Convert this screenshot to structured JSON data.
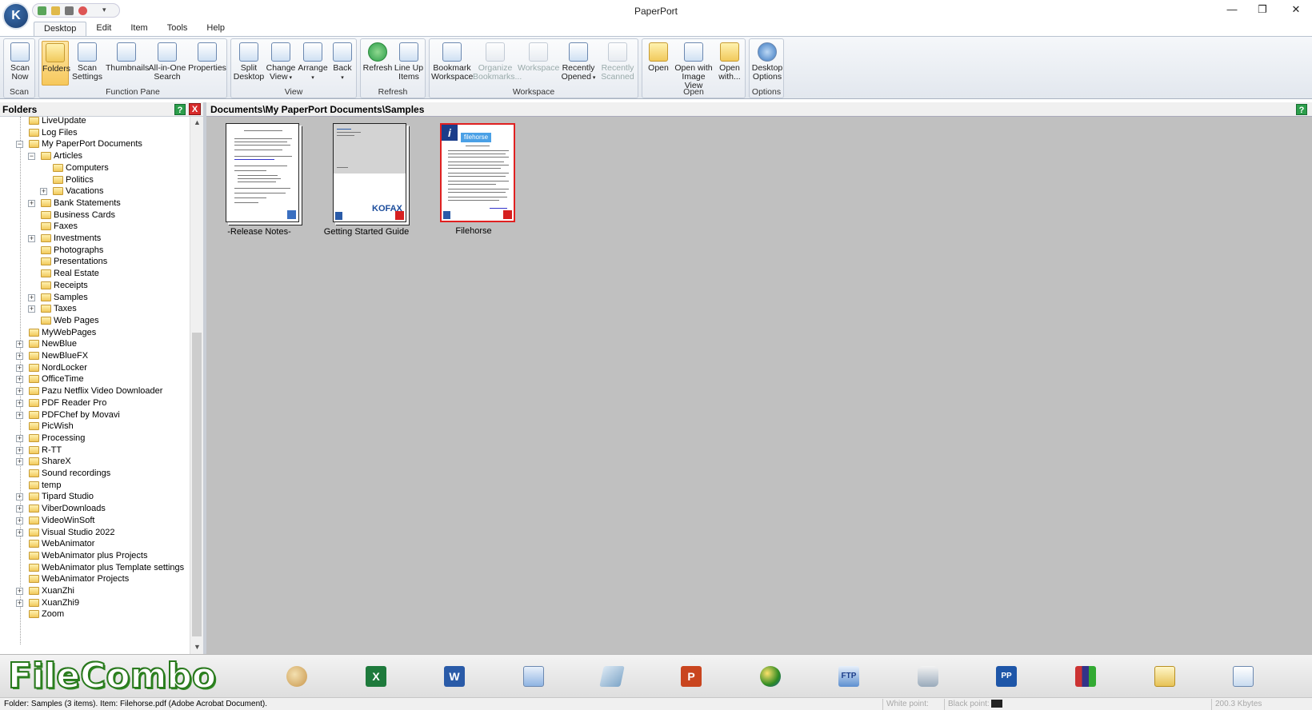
{
  "window": {
    "title": "PaperPort",
    "app_badge": "K PP",
    "minimize": "—",
    "restore": "❐",
    "close": "✕"
  },
  "menu_tabs": [
    "Desktop",
    "Edit",
    "Item",
    "Tools",
    "Help"
  ],
  "ribbon": {
    "groups": [
      {
        "label": "Scan",
        "buttons": [
          {
            "label": "Scan Now",
            "icon": "scanner-icon"
          }
        ]
      },
      {
        "label": "Function Pane",
        "buttons": [
          {
            "label": "Folders",
            "icon": "folders-icon"
          },
          {
            "label": "Scan Settings",
            "icon": "scan-settings-icon"
          },
          {
            "label": "Thumbnails",
            "icon": "thumbnails-icon"
          },
          {
            "label": "All-in-One Search",
            "icon": "binoculars-icon"
          },
          {
            "label": "Properties",
            "icon": "properties-icon"
          }
        ]
      },
      {
        "label": "View",
        "buttons": [
          {
            "label": "Split Desktop",
            "icon": "split-desktop-icon"
          },
          {
            "label": "Change View",
            "icon": "change-view-icon"
          },
          {
            "label": "Arrange",
            "icon": "arrange-icon"
          },
          {
            "label": "Back",
            "icon": "back-icon"
          }
        ]
      },
      {
        "label": "Refresh",
        "buttons": [
          {
            "label": "Refresh",
            "icon": "refresh-icon"
          },
          {
            "label": "Line Up Items",
            "icon": "line-up-icon"
          }
        ]
      },
      {
        "label": "Workspace",
        "buttons": [
          {
            "label": "Bookmark Workspace",
            "icon": "bookmark-icon"
          },
          {
            "label": "Organize Bookmarks...",
            "icon": "organize-bookmarks-icon"
          },
          {
            "label": "Workspace",
            "icon": "workspace-icon"
          },
          {
            "label": "Recently Opened",
            "icon": "recently-opened-icon"
          },
          {
            "label": "Recently Scanned",
            "icon": "recently-scanned-icon"
          }
        ]
      },
      {
        "label": "Open",
        "buttons": [
          {
            "label": "Open",
            "icon": "open-icon"
          },
          {
            "label": "Open with Image View",
            "icon": "image-view-icon"
          },
          {
            "label": "Open with...",
            "icon": "open-with-icon"
          }
        ]
      },
      {
        "label": "Options",
        "buttons": [
          {
            "label": "Desktop Options",
            "icon": "desktop-options-icon"
          }
        ]
      }
    ]
  },
  "folders_pane": {
    "title": "Folders",
    "help": "?",
    "close": "X",
    "items": [
      "LiveUpdate",
      "Log Files",
      "My PaperPort Documents",
      "Articles",
      "Computers",
      "Politics",
      "Vacations",
      "Bank Statements",
      "Business Cards",
      "Faxes",
      "Investments",
      "Photographs",
      "Presentations",
      "Real Estate",
      "Receipts",
      "Samples",
      "Taxes",
      "Web Pages",
      "MyWebPages",
      "NewBlue",
      "NewBlueFX",
      "NordLocker",
      "OfficeTime",
      "Pazu Netflix Video Downloader",
      "PDF Reader Pro",
      "PDFChef by Movavi",
      "PicWish",
      "Processing",
      "R-TT",
      "ShareX",
      "Sound recordings",
      "temp",
      "Tipard Studio",
      "ViberDownloads",
      "VideoWinSoft",
      "Visual Studio 2022",
      "WebAnimator",
      "WebAnimator plus Projects",
      "WebAnimator plus Template settings",
      "WebAnimator Projects",
      "XuanZhi",
      "XuanZhi9",
      "Zoom"
    ],
    "scroll_up": "▲",
    "scroll_down": "▼"
  },
  "desktop": {
    "path": "Documents\\My PaperPort Documents\\Samples",
    "help": "?",
    "items": [
      {
        "caption": "-Release Notes-"
      },
      {
        "caption": "Getting Started Guide",
        "brand": "KOFAX"
      },
      {
        "caption": "Filehorse",
        "brand": "filehorse",
        "badge": "i"
      }
    ]
  },
  "send_to_bar": {
    "logo": "FileCombo",
    "icons": [
      "paint-icon",
      "excel-icon",
      "word-icon",
      "wordpad-icon",
      "eraser-icon",
      "powerpoint-icon",
      "browser-icon",
      "ftp-icon",
      "printer-icon",
      "paperport-icon",
      "people-icon",
      "recycle-icon",
      "scan-doc-icon"
    ],
    "ftp_label": "FTP",
    "word_label": "W",
    "excel_label": "X",
    "ppt_label": "P",
    "pp_label": "PP"
  },
  "status_bar": {
    "text": "Folder: Samples (3 items). Item: Filehorse.pdf (Adobe Acrobat Document).",
    "white_point": "White point:",
    "black_point": "Black point:",
    "size": "200.3 Kbytes"
  },
  "colors": {
    "ribbon_bg": "#e2e7ee",
    "desktop_bg": "#c0c0c0",
    "selected": "#f6c85c",
    "selection_border": "#e02020",
    "logo_green": "#2f8b22"
  }
}
